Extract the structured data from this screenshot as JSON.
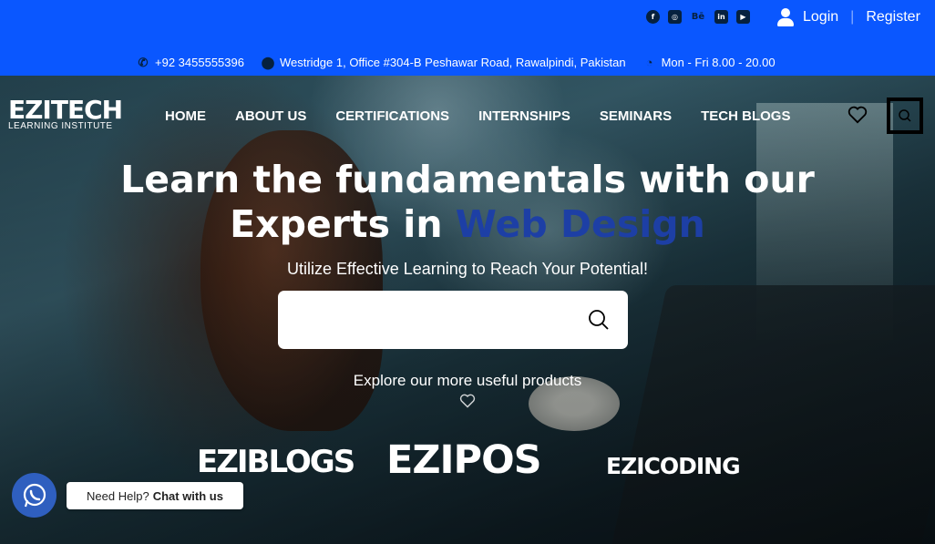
{
  "topbar": {
    "social": [
      {
        "icon": "facebook-icon",
        "glyph": "f"
      },
      {
        "icon": "instagram-icon",
        "glyph": "◎"
      },
      {
        "icon": "behance-icon",
        "glyph": "Bē"
      },
      {
        "icon": "linkedin-icon",
        "glyph": "in"
      },
      {
        "icon": "youtube-icon",
        "glyph": "▶"
      }
    ],
    "login_label": "Login",
    "separator": "|",
    "register_label": "Register",
    "phone": "+92 3455555396",
    "address": "Westridge 1, Office #304-B Peshawar Road, Rawalpindi, Pakistan",
    "hours": "Mon - Fri 8.00 - 20.00",
    "background_color": "#0a57ff"
  },
  "logo": {
    "main": "EZITECH",
    "sub": "LEARNING INSTITUTE"
  },
  "nav": {
    "items": [
      "HOME",
      "ABOUT US",
      "CERTIFICATIONS",
      "INTERNSHIPS",
      "SEMINARS",
      "TECH BLOGS"
    ]
  },
  "hero": {
    "headline_line1": "Learn the fundamentals with our",
    "headline_line2_prefix": "Experts in ",
    "headline_accent": "Web Design",
    "accent_color": "#1d3fa5",
    "subline": "Utilize Effective Learning to Reach Your Potential!",
    "search_placeholder": "",
    "explore_text": "Explore our more useful products"
  },
  "products": [
    "EZIBLOGS",
    "EZIPOS",
    "EZICODING"
  ],
  "chat_widget": {
    "prefix": "Need Help?",
    "action": "Chat with us"
  }
}
